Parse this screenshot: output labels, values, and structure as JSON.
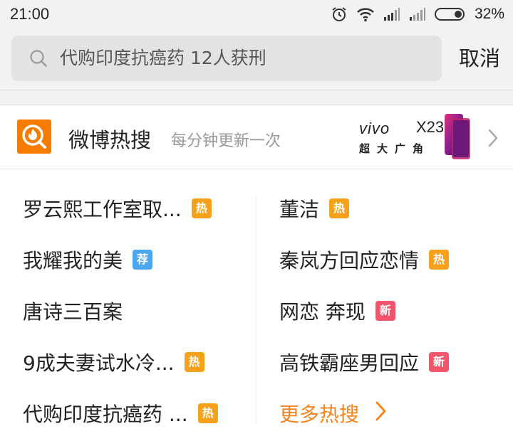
{
  "status_bar": {
    "time": "21:00",
    "battery": "32%",
    "icons": [
      "alarm-icon",
      "wifi-icon",
      "signal-icon",
      "signal-icon",
      "battery-icon"
    ]
  },
  "search": {
    "query": "代购印度抗癌药 12人获刑",
    "cancel_label": "取消"
  },
  "hot_header": {
    "title": "微博热搜",
    "subtitle": "每分钟更新一次",
    "ad": {
      "brand": "vivo",
      "model": "X23",
      "tagline": "超大广角"
    }
  },
  "hot_list": {
    "left": [
      {
        "label": "罗云熙工作室取...",
        "badge": "热",
        "badge_type": "hot"
      },
      {
        "label": "我耀我的美",
        "badge": "荐",
        "badge_type": "rec"
      },
      {
        "label": "唐诗三百案",
        "badge": "",
        "badge_type": ""
      },
      {
        "label": "9成夫妻试水冷...",
        "badge": "热",
        "badge_type": "hot"
      },
      {
        "label": "代购印度抗癌药 ...",
        "badge": "热",
        "badge_type": "hot"
      }
    ],
    "right": [
      {
        "label": "董洁",
        "badge": "热",
        "badge_type": "hot"
      },
      {
        "label": "秦岚方回应恋情",
        "badge": "热",
        "badge_type": "hot"
      },
      {
        "label": "网恋 奔现",
        "badge": "新",
        "badge_type": "new"
      },
      {
        "label": "高铁霸座男回应",
        "badge": "新",
        "badge_type": "new"
      }
    ],
    "more_label": "更多热搜"
  },
  "colors": {
    "accent_orange": "#f5841f",
    "badge_hot": "#f7a01a",
    "badge_rec": "#4aa8ef",
    "badge_new": "#f2556b"
  }
}
